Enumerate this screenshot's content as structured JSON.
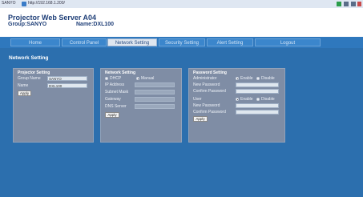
{
  "browser": {
    "logo": "SANYO",
    "url": "http://192.168.1.200/",
    "colors": {
      "titlebar": "#dfe7f2"
    }
  },
  "header": {
    "title": "Projector Web Server A04",
    "group": "Group:SANYO",
    "name": "Name:DXL100"
  },
  "nav": {
    "tabs": [
      {
        "label": "Home"
      },
      {
        "label": "Control Panel"
      },
      {
        "label": "Network Setting"
      },
      {
        "label": "Security Setting"
      },
      {
        "label": "Alert Setting"
      },
      {
        "label": "Logout"
      }
    ],
    "active_index": 2
  },
  "page_title": "Network Setting",
  "projector_setting": {
    "title": "Projector Setting",
    "group_name_label": "Group Name",
    "group_name_value": "SANYO",
    "name_label": "Name",
    "name_value": "DXL100",
    "apply": "Apply"
  },
  "network_setting": {
    "title": "Network Setting",
    "dhcp_label": "DHCP",
    "manual_label": "Manual",
    "ip_label": "IP Address",
    "subnet_label": "Subnet Mask",
    "gateway_label": "Gateway",
    "dns_label": "DNS Server",
    "apply": "Apply"
  },
  "password_setting": {
    "title": "Password Setting",
    "admin_label": "Administrator",
    "enable_label": "Enable",
    "disable_label": "Disable",
    "new_password_label": "New Password",
    "confirm_password_label": "Confirm Password",
    "user_label": "User",
    "apply": "Apply"
  },
  "colors": {
    "nav_bg": "#2f78bd",
    "main_bg": "#2c6fae",
    "panel_bg": "#7f8da5",
    "title_text": "#1f3f78"
  }
}
